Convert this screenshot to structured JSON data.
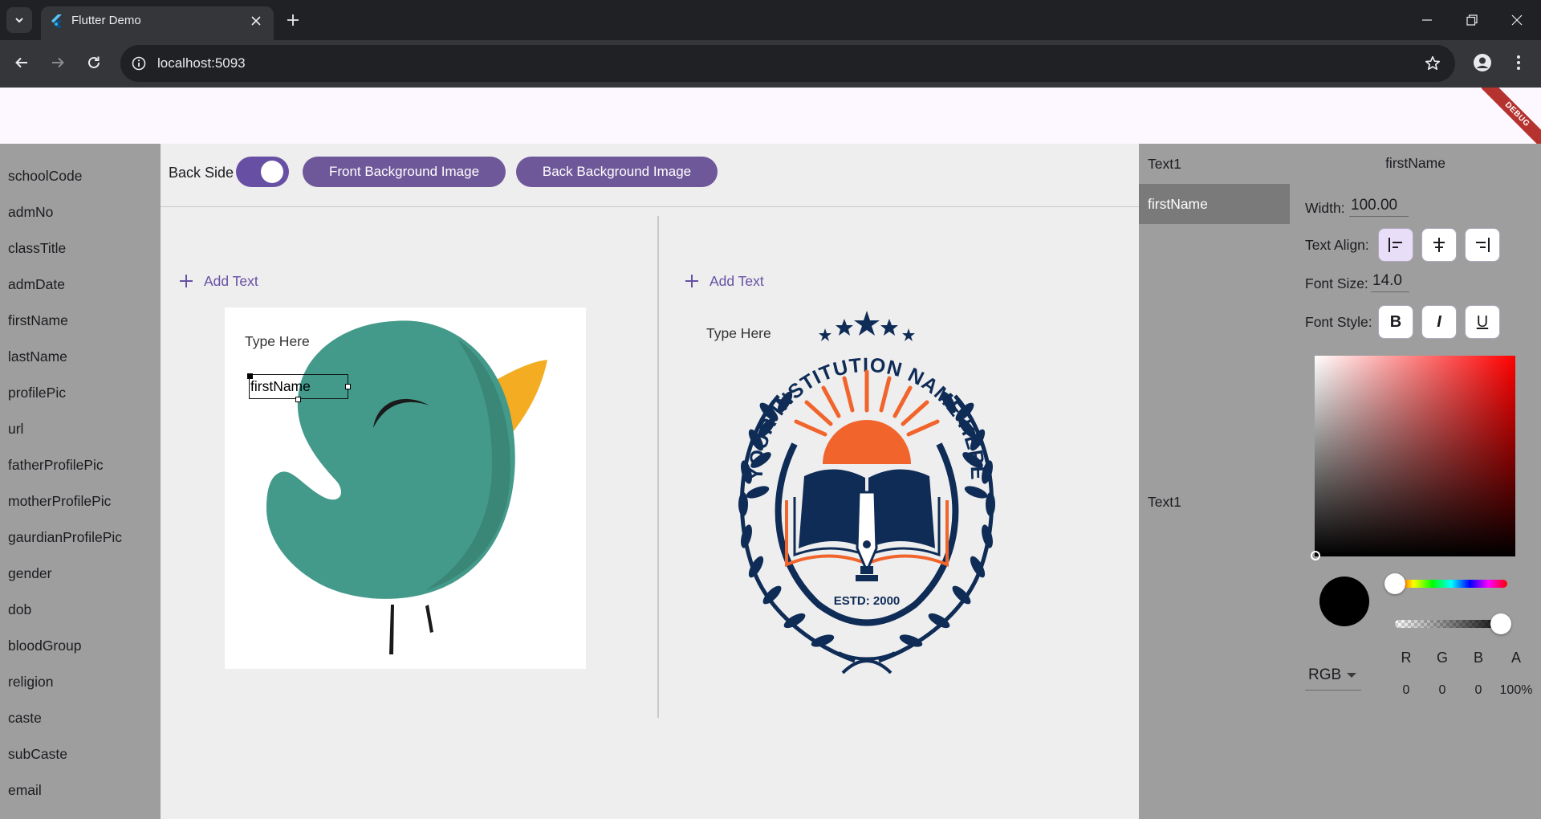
{
  "browser": {
    "tab_title": "Flutter Demo",
    "url": "localhost:5093"
  },
  "app": {
    "debug_banner": "DEBUG"
  },
  "fields": [
    "schoolCode",
    "admNo",
    "classTitle",
    "admDate",
    "firstName",
    "lastName",
    "profilePic",
    "url",
    "fatherProfilePic",
    "motherProfilePic",
    "gaurdianProfilePic",
    "gender",
    "dob",
    "bloodGroup",
    "religion",
    "caste",
    "subCaste",
    "email"
  ],
  "controls": {
    "back_side_label": "Back Side",
    "back_side_on": true,
    "front_bg_button": "Front Background Image",
    "back_bg_button": "Back Background Image"
  },
  "front": {
    "add_text": "Add Text",
    "type_here": "Type Here",
    "selected_text": "firstName"
  },
  "back": {
    "add_text": "Add Text",
    "type_here": "Type Here",
    "logo_text_arc": "YOUR INSTITUTION NAME HERE",
    "logo_estd": "ESTD: 2000"
  },
  "layers": {
    "front": [
      "Text1",
      "firstName"
    ],
    "back": [
      "Text1"
    ],
    "selected": "firstName"
  },
  "properties": {
    "title": "firstName",
    "width_label": "Width:",
    "width_value": "100.00",
    "text_align_label": "Text Align:",
    "font_size_label": "Font Size:",
    "font_size_value": "14.0",
    "font_style_label": "Font Style:",
    "font_style_bold": "B",
    "font_style_italic": "I",
    "font_style_underline": "U",
    "color": {
      "mode": "RGB",
      "channel_headers": [
        "R",
        "G",
        "B",
        "A"
      ],
      "channel_values": [
        "0",
        "0",
        "0",
        "100%"
      ],
      "hue_color": "#ff0000",
      "current_color": "#000000"
    }
  },
  "colors": {
    "accent": "#6750a4",
    "button_fill": "#6e5899",
    "bird_body": "#439a8a",
    "bird_beak": "#f4ac22",
    "logo_navy": "#0f2c57",
    "logo_orange": "#f1642c"
  }
}
